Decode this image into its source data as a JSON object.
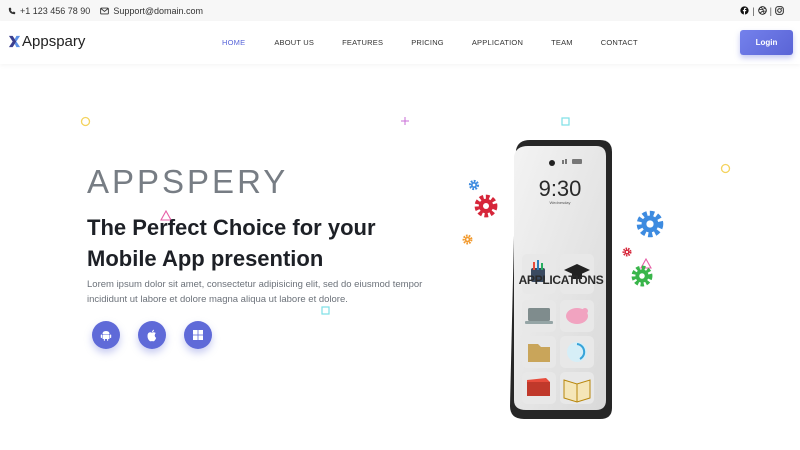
{
  "topbar": {
    "phone": "+1 123 456 78 90",
    "email": "Support@domain.com",
    "social_icons": [
      "facebook-icon",
      "dribbble-icon",
      "instagram-icon"
    ],
    "separator": "|"
  },
  "navbar": {
    "brand": "Appspary",
    "links": [
      "HOME",
      "ABOUT US",
      "FEATURES",
      "PRICING",
      "APPLICATION",
      "TEAM",
      "CONTACT"
    ],
    "active_link": "HOME",
    "login_label": "Login"
  },
  "hero": {
    "eyebrow": "APPSPERY",
    "headline": "The Perfect Choice for your Mobile App presention",
    "description": "Lorem ipsum dolor sit amet, consectetur adipisicing elit, sed do eiusmod tempor incididunt ut labore et dolore magna aliqua ut labore et dolore.",
    "store_buttons": [
      "android-icon",
      "apple-icon",
      "windows-icon"
    ]
  },
  "phone": {
    "time": "9:30",
    "day": "Wednesday",
    "screen_title": "APPLICATIONS"
  },
  "colors": {
    "accent": "#5f6ad8",
    "active_nav": "#5865d9",
    "headline": "#1d2026"
  }
}
